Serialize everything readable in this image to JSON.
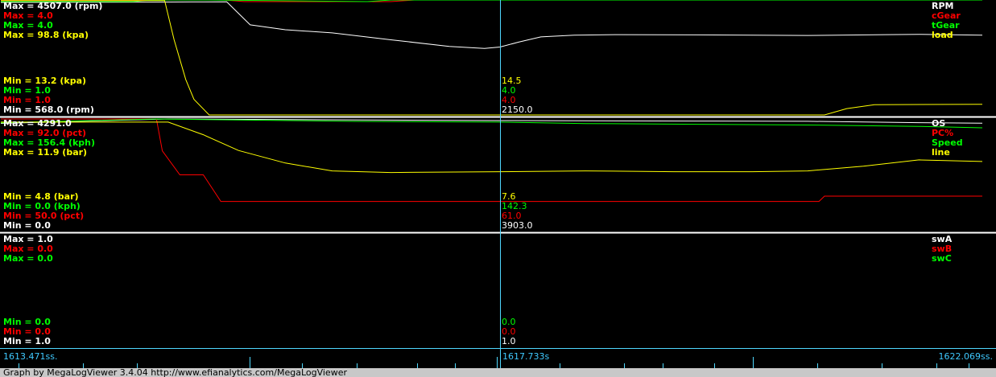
{
  "chart_data": {
    "type": "line",
    "colors": {
      "white": "#ffffff",
      "red": "#ff0000",
      "green": "#00ff00",
      "yellow": "#ffff00",
      "cursor": "#4fd8ff",
      "axis_text": "#3fc9ff"
    },
    "time": {
      "start": "1613.471ss.",
      "cursor": "1617.733s",
      "end": "1622.069ss.",
      "start_s": 1613.471,
      "cursor_s": 1617.733,
      "end_s": 1622.069
    },
    "footer": "Graph by MegaLogViewer 3.4.04 http://www.efianalytics.com/MegaLogViewer",
    "panels": [
      {
        "id": "p1",
        "series": [
          {
            "name": "RPM",
            "color": "white",
            "max": 4507.0,
            "min": 568.0,
            "max_label": "Max = 4507.0 (rpm)",
            "min_label": "Min = 568.0 (rpm)",
            "cursor_value": "2150.0",
            "x": [
              1613.471,
              1614.8,
              1615.1,
              1615.4,
              1615.6,
              1615.9,
              1616.3,
              1616.8,
              1617.3,
              1617.6,
              1617.733,
              1617.9,
              1618.1,
              1618.4,
              1618.8,
              1619.5,
              1620.5,
              1621.2,
              1621.5,
              1622.069
            ],
            "y": [
              4480,
              4490,
              4495,
              4500,
              3700,
              3530,
              3420,
              3180,
              2950,
              2880,
              2930,
              3100,
              3280,
              3340,
              3360,
              3350,
              3330,
              3360,
              3370,
              3340
            ]
          },
          {
            "name": "cGear",
            "color": "red",
            "max": 4.0,
            "min": 1.0,
            "max_label": "Max = 4.0",
            "min_label": "Min = 1.0",
            "cursor_value": "4.0",
            "x": [
              1613.471,
              1615.0,
              1615.28,
              1615.38,
              1615.55,
              1616.8,
              1617.0,
              1617.733,
              1622.069
            ],
            "y": [
              5.1,
              5.1,
              5.1,
              5.1,
              4.0,
              4.0,
              4.6,
              5.1,
              5.1
            ]
          },
          {
            "name": "tGear",
            "color": "green",
            "max": 4.0,
            "min": 1.0,
            "max_label": "Max = 4.0",
            "min_label": "Min = 1.0",
            "cursor_value": "4.0",
            "x": [
              1613.471,
              1614.6,
              1614.75,
              1615.15,
              1615.25,
              1616.6,
              1616.8,
              1617.733,
              1622.069
            ],
            "y": [
              4.0,
              4.0,
              5.1,
              5.1,
              4.2,
              4.0,
              5.1,
              5.1,
              5.1
            ]
          },
          {
            "name": "load",
            "color": "yellow",
            "max": 98.8,
            "min": 13.2,
            "max_label": "Max = 98.8 (kpa)",
            "min_label": "Min = 13.2 (kpa)",
            "cursor_value": "14.5",
            "x": [
              1613.471,
              1614.87,
              1614.95,
              1615.05,
              1615.12,
              1615.25,
              1617.733,
              1620.65,
              1620.85,
              1621.1,
              1622.069
            ],
            "y": [
              99.5,
              99.5,
              70,
              40,
              25,
              13.2,
              13.2,
              13.2,
              18,
              21,
              21.3
            ]
          }
        ]
      },
      {
        "id": "p2",
        "series": [
          {
            "name": "OS",
            "color": "white",
            "max": 4291.0,
            "min": 0.0,
            "max_label": "Max = 4291.0",
            "min_label": "Min = 0.0",
            "cursor_value": "3903.0",
            "x": [
              1613.471,
              1614.9,
              1617.733,
              1618.5,
              1619.5,
              1620.5,
              1621.5,
              1622.069
            ],
            "y": [
              4120,
              4291,
              4230,
              4220,
              4210,
              4200,
              4150,
              4130
            ]
          },
          {
            "name": "PC%",
            "color": "red",
            "max": 92.0,
            "min": 50.0,
            "max_label": "Max = 92.0 (pct)",
            "min_label": "Min = 50.0 (pct)",
            "cursor_value": "61.0",
            "x": [
              1613.471,
              1614.8,
              1614.85,
              1615.0,
              1615.2,
              1615.35,
              1617.733,
              1620.6,
              1620.65,
              1622.069
            ],
            "y": [
              92,
              92,
              80,
              71,
              71,
              61,
              61,
              61,
              63,
              63
            ]
          },
          {
            "name": "Speed",
            "color": "green",
            "max": 156.4,
            "min": 0.0,
            "max_label": "Max = 156.4 (kph)",
            "min_label": "Min = 0.0 (kph)",
            "cursor_value": "142.3",
            "x": [
              1613.471,
              1614.8,
              1615.5,
              1616.5,
              1617.733,
              1618.5,
              1619.5,
              1620.5,
              1621.5,
              1622.069
            ],
            "y": [
              151,
              156.4,
              155,
              153,
              152,
              150,
              149,
              148,
              146,
              144
            ]
          },
          {
            "name": "line",
            "color": "yellow",
            "max": 11.9,
            "min": 4.8,
            "max_label": "Max = 11.9 (bar)",
            "min_label": "Min = 4.8 (bar)",
            "cursor_value": "7.6",
            "x": [
              1613.471,
              1614.9,
              1615.2,
              1615.5,
              1615.9,
              1616.3,
              1616.8,
              1617.733,
              1618.5,
              1619.3,
              1620.0,
              1620.5,
              1621.0,
              1621.5,
              1622.069
            ],
            "y": [
              11.7,
              11.7,
              10.9,
              9.9,
              9.1,
              8.6,
              8.5,
              8.55,
              8.6,
              8.55,
              8.55,
              8.6,
              8.9,
              9.3,
              9.2
            ]
          }
        ]
      },
      {
        "id": "p3",
        "series": [
          {
            "name": "swA",
            "color": "white",
            "max": 1.0,
            "min": 1.0,
            "max_label": "Max = 1.0",
            "min_label": "Min = 1.0",
            "cursor_value": "1.0",
            "x": [],
            "y": []
          },
          {
            "name": "swB",
            "color": "red",
            "max": 0.0,
            "min": 0.0,
            "max_label": "Max = 0.0",
            "min_label": "Min = 0.0",
            "cursor_value": "0.0",
            "x": [],
            "y": []
          },
          {
            "name": "swC",
            "color": "green",
            "max": 0.0,
            "min": 0.0,
            "max_label": "Max = 0.0",
            "min_label": "Min = 0.0",
            "cursor_value": "0.0",
            "x": [],
            "y": []
          }
        ]
      }
    ]
  }
}
